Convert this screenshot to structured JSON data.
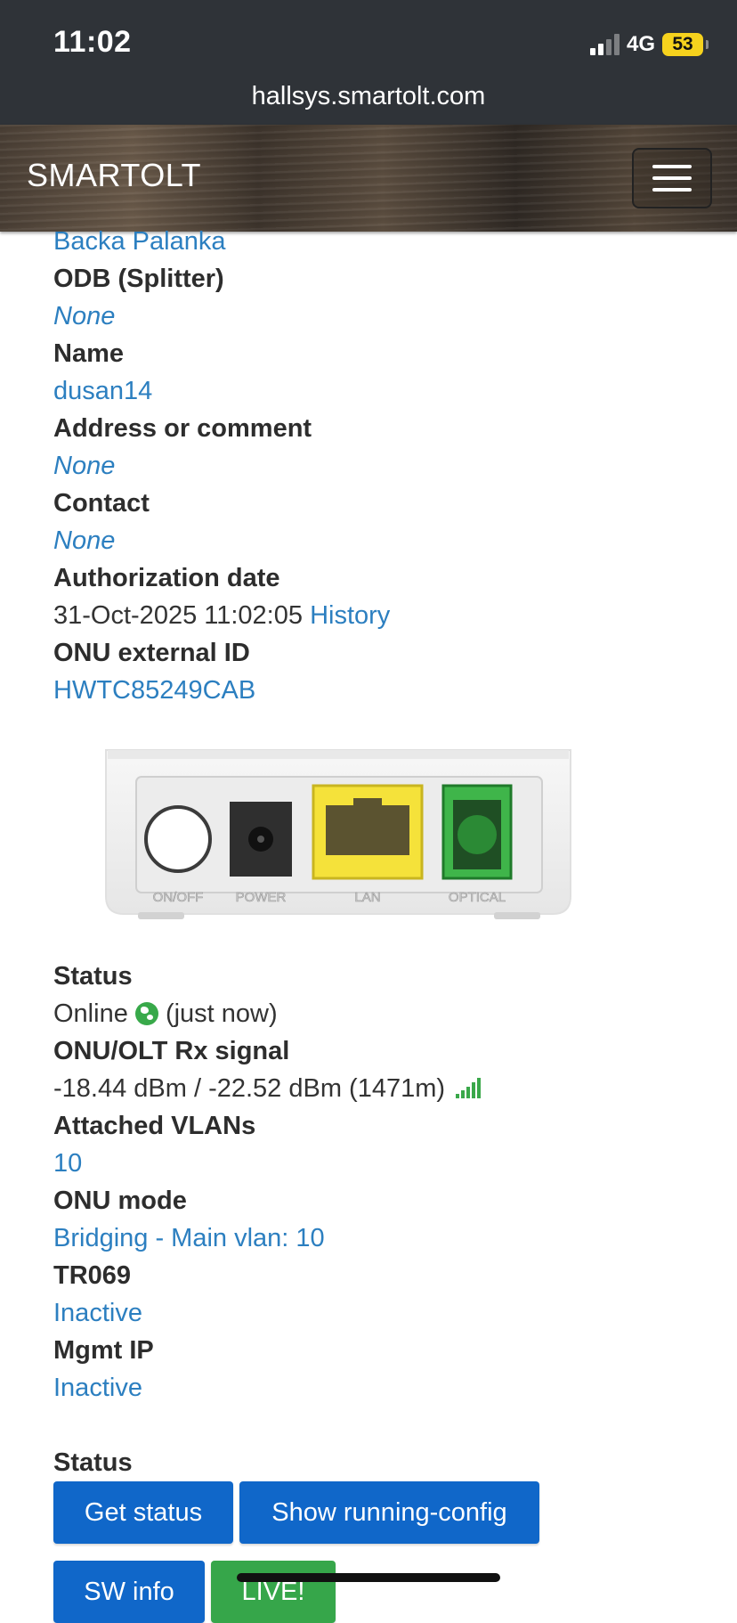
{
  "status_bar": {
    "time": "11:02",
    "network": "4G",
    "battery": "53",
    "url": "hallsys.smartolt.com"
  },
  "navbar": {
    "brand": "SMARTOLT",
    "menu_icon": "hamburger-menu-icon"
  },
  "details": {
    "location_value": "Backa Palanka",
    "odb_label": "ODB (Splitter)",
    "odb_value": "None",
    "name_label": "Name",
    "name_value": "dusan14",
    "address_label": "Address or comment",
    "address_value": "None",
    "contact_label": "Contact",
    "contact_value": "None",
    "auth_date_label": "Authorization date",
    "auth_date_value": "31-Oct-2025 11:02:05",
    "auth_history_link": "History",
    "external_id_label": "ONU external ID",
    "external_id_value": "HWTC85249CAB"
  },
  "onu_image": {
    "ports": [
      "ON/OFF",
      "POWER",
      "LAN",
      "OPTICAL"
    ]
  },
  "status_section": {
    "status_label": "Status",
    "status_value": "Online",
    "status_time": "(just now)",
    "signal_label": "ONU/OLT Rx signal",
    "signal_value": "-18.44 dBm / -22.52 dBm (1471m)",
    "vlans_label": "Attached VLANs",
    "vlans_value": "10",
    "mode_label": "ONU mode",
    "mode_value": "Bridging - Main vlan: 10",
    "tr069_label": "TR069",
    "tr069_value": "Inactive",
    "mgmt_label": "Mgmt IP",
    "mgmt_value": "Inactive"
  },
  "actions": {
    "heading": "Status",
    "get_status": "Get status",
    "show_config": "Show running-config",
    "sw_info": "SW info",
    "live": "LIVE!"
  },
  "colors": {
    "link": "#2c7fc0",
    "primary_button": "#1067c9",
    "live_button": "#36a64a",
    "online_icon": "#38a94a"
  }
}
